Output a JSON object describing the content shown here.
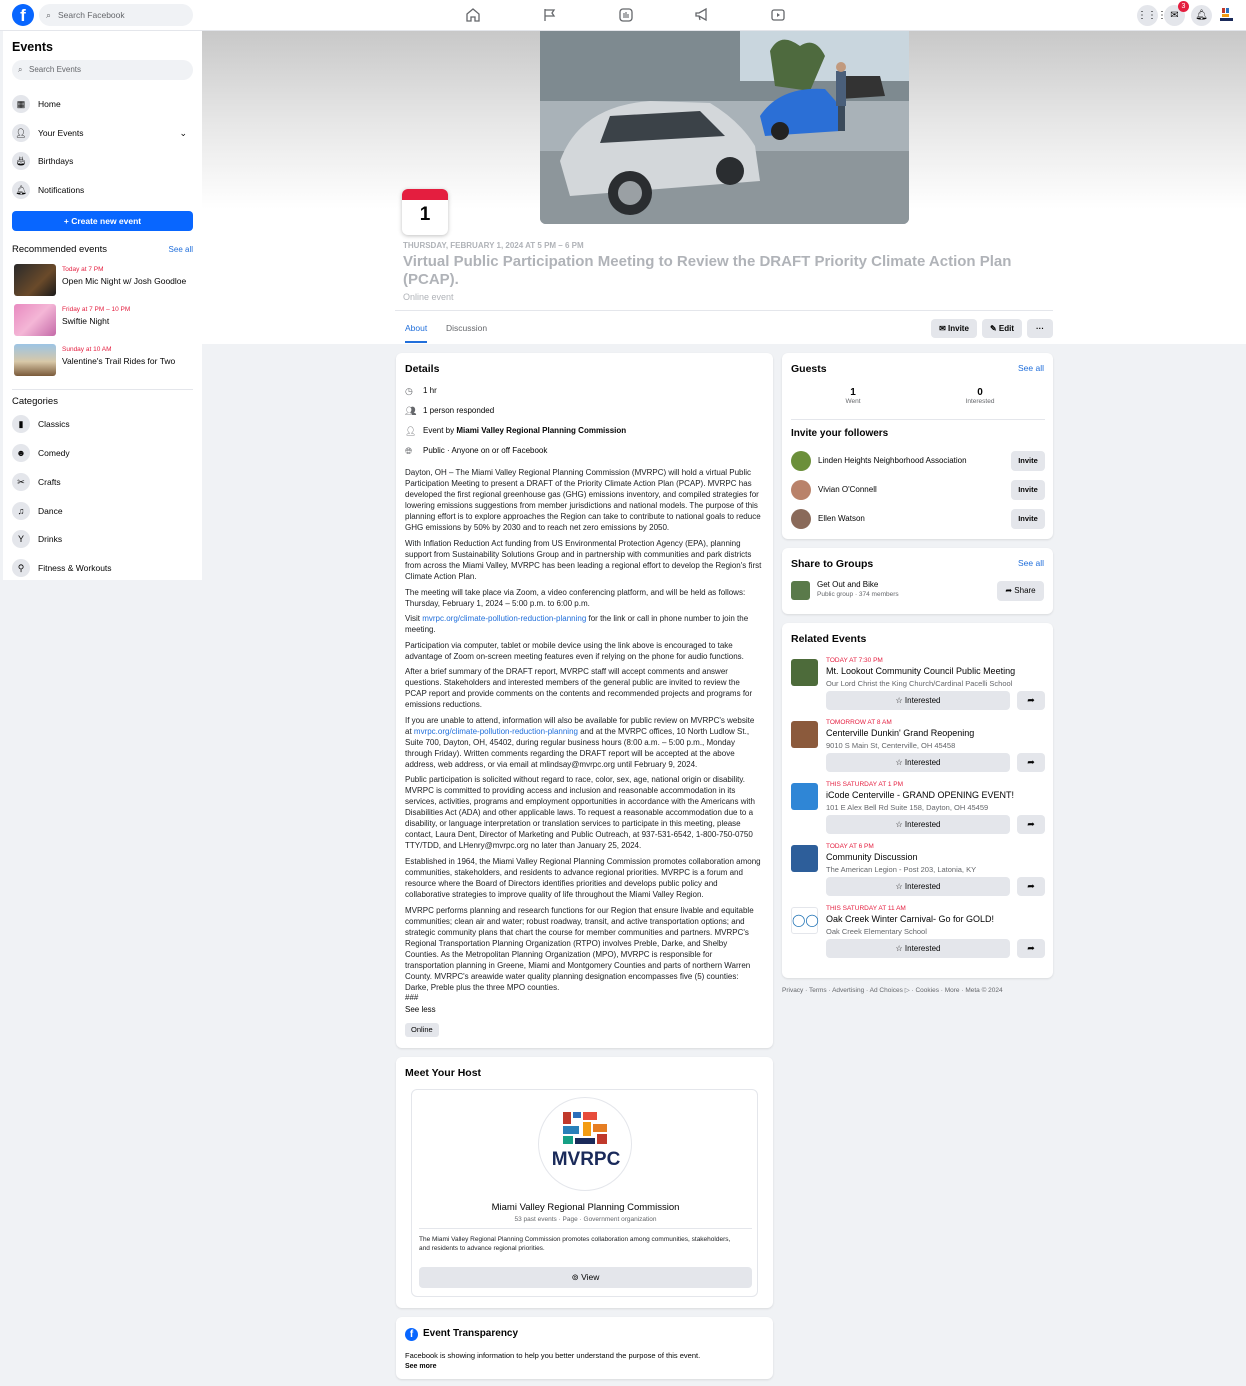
{
  "topbar": {
    "logo": "f",
    "search_placeholder": "Search Facebook",
    "notification_count": "3",
    "nav_icons": [
      "home-icon",
      "flag-icon",
      "marketplace-icon",
      "megaphone-icon",
      "video-icon"
    ]
  },
  "sidebar": {
    "title": "Events",
    "search_placeholder": "Search Events",
    "items": [
      {
        "label": "Home",
        "icon": "calendar-icon"
      },
      {
        "label": "Your Events",
        "icon": "person-icon"
      },
      {
        "label": "Birthdays",
        "icon": "cake-icon"
      },
      {
        "label": "Notifications",
        "icon": "bell-icon"
      }
    ],
    "create_label": "+  Create new event",
    "recommended_title": "Recommended events",
    "see_all": "See all",
    "recommended": [
      {
        "when": "Today at 7 PM",
        "name": "Open Mic Night w/ Josh Goodloe"
      },
      {
        "when": "Friday at 7 PM – 10 PM",
        "name": "Swiftie Night"
      },
      {
        "when": "Sunday at 10 AM",
        "name": "Valentine's Trail Rides for Two"
      }
    ],
    "categories_title": "Categories",
    "categories": [
      {
        "label": "Classics",
        "icon": "book-icon"
      },
      {
        "label": "Comedy",
        "icon": "smile-icon"
      },
      {
        "label": "Crafts",
        "icon": "scissors-icon"
      },
      {
        "label": "Dance",
        "icon": "dance-icon"
      },
      {
        "label": "Drinks",
        "icon": "cocktail-icon"
      },
      {
        "label": "Fitness & Workouts",
        "icon": "fitness-icon"
      }
    ]
  },
  "event": {
    "day": "1",
    "datetime": "THURSDAY, FEBRUARY 1, 2024 AT 5 PM – 6 PM",
    "title": "Virtual Public Participation Meeting to Review the DRAFT Priority Climate Action Plan (PCAP).",
    "location": "Online event",
    "tabs": [
      "About",
      "Discussion"
    ],
    "actions": {
      "invite": "Invite",
      "edit": "Edit",
      "more": "···"
    }
  },
  "details": {
    "title": "Details",
    "duration": "1 hr",
    "responded": "1 person responded",
    "host_prefix": "Event by ",
    "host": "Miami Valley Regional Planning Commission",
    "privacy": "Public · Anyone on or off Facebook",
    "paragraphs": [
      "Dayton, OH – The Miami Valley Regional Planning Commission (MVRPC) will hold a virtual Public Participation Meeting to present a DRAFT of the Priority Climate Action Plan (PCAP). MVRPC has developed the first regional greenhouse gas (GHG) emissions inventory, and compiled strategies for lowering emissions suggestions from member jurisdictions and national models. The purpose of this planning effort is to explore approaches the Region can take to contribute to national goals to reduce GHG emissions by 50% by 2030 and to reach net zero emissions by 2050.",
      "With Inflation Reduction Act funding from US Environmental Protection Agency (EPA), planning support from Sustainability Solutions Group and in partnership with communities and park districts from across the Miami Valley, MVRPC has been leading a regional effort to develop the Region's first Climate Action Plan.",
      "The meeting will take place via Zoom, a video conferencing platform, and will be held as follows: Thursday, February 1, 2024 – 5:00 p.m. to 6:00 p.m."
    ],
    "visit_prefix": "Visit ",
    "visit_link": "mvrpc.org/climate-pollution-reduction-planning",
    "visit_suffix": " for the link or call in phone number to join the meeting.",
    "paragraphs2": [
      "Participation via computer, tablet or mobile device using the link above is encouraged to take advantage of Zoom on-screen meeting features even if relying on the phone for audio functions.",
      "After a brief summary of the DRAFT report, MVRPC staff will accept comments and answer questions. Stakeholders and interested members of the general public are invited to review the PCAP report and provide comments on the contents and recommended projects and programs for emissions reductions."
    ],
    "unable_prefix": "If you are unable to attend, information will also be available for public review on MVRPC's website at ",
    "unable_link": "mvrpc.org/climate-pollution-reduction-planning",
    "unable_suffix": " and at the MVRPC offices, 10 North Ludlow St., Suite 700, Dayton, OH, 45402, during regular business hours (8:00 a.m. – 5:00 p.m., Monday through Friday). Written comments regarding the DRAFT report will be accepted at the above address, web address, or via email at mlindsay@mvrpc.org until February 9, 2024.",
    "paragraphs3": [
      "Public participation is solicited without regard to race, color, sex, age, national origin or disability. MVRPC is committed to providing access and inclusion and reasonable accommodation in its services, activities, programs and employment opportunities in accordance with the Americans with Disabilities Act (ADA) and other applicable laws. To request a reasonable accommodation due to a disability, or language interpretation or translation services to participate in this meeting, please contact, Laura Dent, Director of Marketing and Public Outreach, at 937-531-6542, 1-800-750-0750 TTY/TDD, and LHenry@mvrpc.org no later than January 25, 2024.",
      "Established in 1964, the Miami Valley Regional Planning Commission promotes collaboration among communities, stakeholders, and residents to advance regional priorities. MVRPC is a forum and resource where the Board of Directors identifies priorities and develops public policy and collaborative strategies to improve quality of life throughout the Miami Valley Region.",
      "MVRPC performs planning and research functions for our Region that ensure livable and equitable communities; clean air and water; robust roadway, transit, and active transportation options; and strategic community plans that chart the course for member communities and partners. MVRPC's Regional Transportation Planning Organization (RTPO) involves Preble, Darke, and Shelby Counties. As the Metropolitan Planning Organization (MPO), MVRPC is responsible for transportation planning in Greene, Miami and Montgomery Counties and parts of northern Warren County. MVRPC's areawide water quality planning designation encompasses five (5) counties: Darke, Preble plus the three MPO counties."
    ],
    "end_mark": "###",
    "see_less": "See less",
    "chip": "Online"
  },
  "host": {
    "title": "Meet Your Host",
    "logo_text": "MVRPC",
    "name": "Miami Valley Regional Planning Commission",
    "meta": "53 past events · Page · Government organization",
    "desc": "The Miami Valley Regional Planning Commission promotes collaboration among communities, stakeholders, and residents to advance regional priorities.",
    "view": "View"
  },
  "transparency": {
    "title": "Event Transparency",
    "text": "Facebook is showing information to help you better understand the purpose of this event.",
    "see_more": "See more"
  },
  "guests": {
    "title": "Guests",
    "see_all": "See all",
    "went": "1",
    "went_label": "Went",
    "interested": "0",
    "interested_label": "Interested",
    "invite_title": "Invite your followers",
    "invite_label": "Invite",
    "followers": [
      {
        "name": "Linden Heights Neighborhood Association",
        "color": "#6b8f3a"
      },
      {
        "name": "Vivian O'Connell",
        "color": "#b9826a"
      },
      {
        "name": "Ellen Watson",
        "color": "#8a6a5a"
      }
    ]
  },
  "groups": {
    "title": "Share to Groups",
    "see_all": "See all",
    "name": "Get Out and Bike",
    "meta": "Public group · 374 members",
    "share": "Share"
  },
  "related": {
    "title": "Related Events",
    "interested_label": "Interested",
    "items": [
      {
        "when": "TODAY AT 7:30 PM",
        "name": "Mt. Lookout Community Council Public Meeting",
        "loc": "Our Lord Christ the King Church/Cardinal Pacelli School",
        "color": "#4d6b3a"
      },
      {
        "when": "TOMORROW AT 8 AM",
        "name": "Centerville Dunkin' Grand Reopening",
        "loc": "9010 S Main St, Centerville, OH 45458",
        "color": "#8b5a3c"
      },
      {
        "when": "THIS SATURDAY AT 1 PM",
        "name": "iCode Centerville - GRAND OPENING EVENT!",
        "loc": "101 E Alex Bell Rd Suite 158, Dayton, OH 45459",
        "color": "#2f86d6"
      },
      {
        "when": "TODAY AT 6 PM",
        "name": "Community Discussion",
        "loc": "The American Legion - Post 203, Latonia, KY",
        "color": "#2d5e9a"
      },
      {
        "when": "THIS SATURDAY AT 11 AM",
        "name": "Oak Creek Winter Carnival- Go for GOLD!",
        "loc": "Oak Creek Elementary School",
        "color": "#ffffff"
      }
    ]
  },
  "footer": "Privacy · Terms · Advertising · Ad Choices ▷ · Cookies · More · Meta © 2024",
  "colors": {
    "accent": "#0866ff",
    "link": "#216fdb",
    "date_red": "#e41e3f"
  }
}
